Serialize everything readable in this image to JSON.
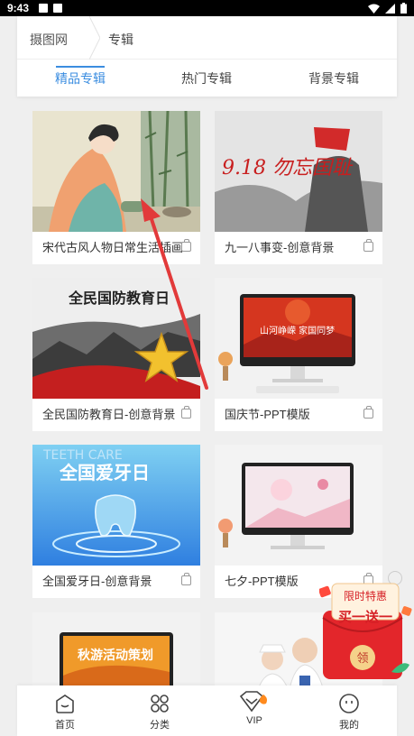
{
  "status_bar": {
    "time": "9:43"
  },
  "breadcrumb": {
    "home": "摄图网",
    "current": "专辑"
  },
  "tabs": [
    {
      "label": "精品专辑",
      "active": true
    },
    {
      "label": "热门专辑",
      "active": false
    },
    {
      "label": "背景专辑",
      "active": false
    }
  ],
  "cards": [
    {
      "caption": "宋代古风人物日常生活插画",
      "image": "ancient-woman-illustration"
    },
    {
      "caption": "九一八事变-创意背景",
      "image": "918-poster-image",
      "image_text": "9.18 勿忘国耻"
    },
    {
      "caption": "全民国防教育日-创意背景",
      "image": "defense-day-image",
      "image_text": "全民国防教育日"
    },
    {
      "caption": "国庆节-PPT模版",
      "image": "national-day-ppt-image",
      "image_text": "山河峥嵘 家国同梦"
    },
    {
      "caption": "全国爱牙日-创意背景",
      "image": "tooth-day-image",
      "image_text": "全国爱牙日",
      "image_subtext": "TEETH CARE"
    },
    {
      "caption": "七夕-PPT模版",
      "image": "qixi-ppt-image"
    },
    {
      "caption": "",
      "image": "autumn-activity-image",
      "image_text": "秋游活动策划"
    },
    {
      "caption": "",
      "image": "doctors-photo-image"
    }
  ],
  "promo": {
    "line1": "限时特惠",
    "line2": "买一送一",
    "button": "领"
  },
  "bottom_nav": [
    {
      "label": "首页",
      "icon": "home-icon"
    },
    {
      "label": "分类",
      "icon": "category-icon"
    },
    {
      "label": "VIP",
      "icon": "vip-diamond-icon"
    },
    {
      "label": "我的",
      "icon": "profile-icon"
    }
  ],
  "colors": {
    "accent": "#3b8de0",
    "promo_red": "#e3262b",
    "promo_gold": "#f5d28a"
  }
}
